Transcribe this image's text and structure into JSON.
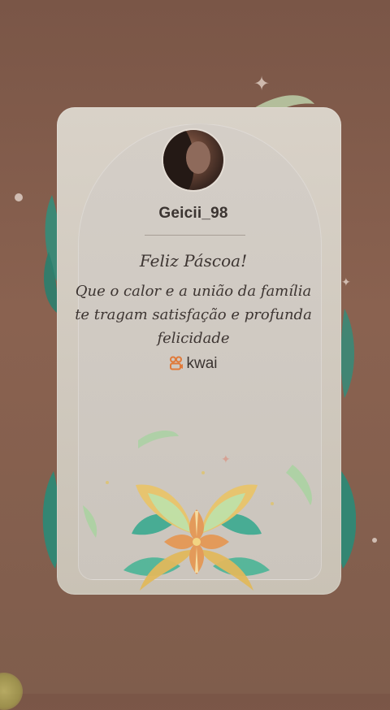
{
  "card": {
    "username": "Geicii_98",
    "greeting_title": "Feliz Páscoa!",
    "greeting_body": "Que o calor e a união da família te tragam satisfação e profunda felicidade",
    "brand_name": "kwai"
  },
  "icons": {
    "avatar": "profile-photo",
    "brand": "kwai-logo-icon",
    "sparkle": "sparkle-icon"
  },
  "colors": {
    "background": "#7a5647",
    "card": "#d9d2c8",
    "text": "#3d3532",
    "brand_orange": "#e07a3a",
    "flower_yellow": "#e8c46a",
    "flower_green": "#a9d4a0",
    "flower_teal": "#2f9e8c"
  }
}
